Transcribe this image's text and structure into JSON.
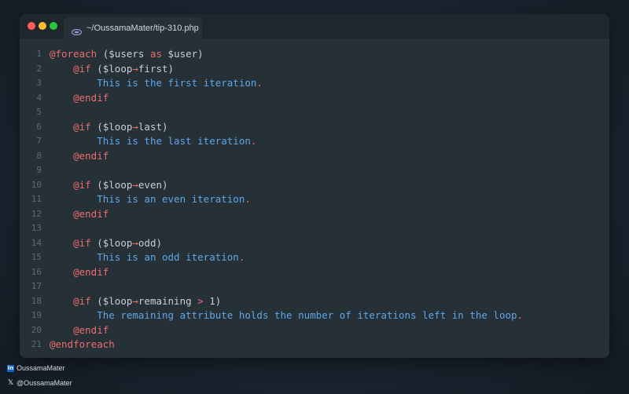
{
  "window": {
    "tab_title": "~/OussamaMater/tip-310.php",
    "traffic_lights": {
      "close": "#ff5f57",
      "minimize": "#febc2e",
      "zoom": "#28c840"
    }
  },
  "colors": {
    "keyword": "#ee6d6d",
    "string_text": "#5fa6e8",
    "plain": "#c9ced3",
    "line_number": "#5d6b76"
  },
  "code": {
    "lines": [
      {
        "n": "1",
        "tokens": [
          {
            "t": "kw",
            "v": "@foreach"
          },
          {
            "t": "plain",
            "v": " ($users "
          },
          {
            "t": "kw",
            "v": "as"
          },
          {
            "t": "plain",
            "v": " $user)"
          }
        ]
      },
      {
        "n": "2",
        "tokens": [
          {
            "t": "plain",
            "v": "    "
          },
          {
            "t": "kw",
            "v": "@if"
          },
          {
            "t": "plain",
            "v": " ($loop"
          },
          {
            "t": "op",
            "v": "→"
          },
          {
            "t": "plain",
            "v": "first)"
          }
        ]
      },
      {
        "n": "3",
        "tokens": [
          {
            "t": "plain",
            "v": "        "
          },
          {
            "t": "text",
            "v": "This is the first iteration"
          },
          {
            "t": "kw",
            "v": "."
          }
        ]
      },
      {
        "n": "4",
        "tokens": [
          {
            "t": "plain",
            "v": "    "
          },
          {
            "t": "kw",
            "v": "@endif"
          }
        ]
      },
      {
        "n": "5",
        "tokens": []
      },
      {
        "n": "6",
        "tokens": [
          {
            "t": "plain",
            "v": "    "
          },
          {
            "t": "kw",
            "v": "@if"
          },
          {
            "t": "plain",
            "v": " ($loop"
          },
          {
            "t": "op",
            "v": "→"
          },
          {
            "t": "plain",
            "v": "last)"
          }
        ]
      },
      {
        "n": "7",
        "tokens": [
          {
            "t": "plain",
            "v": "        "
          },
          {
            "t": "text",
            "v": "This is the last iteration"
          },
          {
            "t": "kw",
            "v": "."
          }
        ]
      },
      {
        "n": "8",
        "tokens": [
          {
            "t": "plain",
            "v": "    "
          },
          {
            "t": "kw",
            "v": "@endif"
          }
        ]
      },
      {
        "n": "9",
        "tokens": []
      },
      {
        "n": "10",
        "tokens": [
          {
            "t": "plain",
            "v": "    "
          },
          {
            "t": "kw",
            "v": "@if"
          },
          {
            "t": "plain",
            "v": " ($loop"
          },
          {
            "t": "op",
            "v": "→"
          },
          {
            "t": "plain",
            "v": "even)"
          }
        ]
      },
      {
        "n": "11",
        "tokens": [
          {
            "t": "plain",
            "v": "        "
          },
          {
            "t": "text",
            "v": "This is an even iteration"
          },
          {
            "t": "kw",
            "v": "."
          }
        ]
      },
      {
        "n": "12",
        "tokens": [
          {
            "t": "plain",
            "v": "    "
          },
          {
            "t": "kw",
            "v": "@endif"
          }
        ]
      },
      {
        "n": "13",
        "tokens": []
      },
      {
        "n": "14",
        "tokens": [
          {
            "t": "plain",
            "v": "    "
          },
          {
            "t": "kw",
            "v": "@if"
          },
          {
            "t": "plain",
            "v": " ($loop"
          },
          {
            "t": "op",
            "v": "→"
          },
          {
            "t": "plain",
            "v": "odd)"
          }
        ]
      },
      {
        "n": "15",
        "tokens": [
          {
            "t": "plain",
            "v": "        "
          },
          {
            "t": "text",
            "v": "This is an odd iteration"
          },
          {
            "t": "kw",
            "v": "."
          }
        ]
      },
      {
        "n": "16",
        "tokens": [
          {
            "t": "plain",
            "v": "    "
          },
          {
            "t": "kw",
            "v": "@endif"
          }
        ]
      },
      {
        "n": "17",
        "tokens": []
      },
      {
        "n": "18",
        "tokens": [
          {
            "t": "plain",
            "v": "    "
          },
          {
            "t": "kw",
            "v": "@if"
          },
          {
            "t": "plain",
            "v": " ($loop"
          },
          {
            "t": "op",
            "v": "→"
          },
          {
            "t": "plain",
            "v": "remaining "
          },
          {
            "t": "op",
            "v": ">"
          },
          {
            "t": "plain",
            "v": " 1)"
          }
        ]
      },
      {
        "n": "19",
        "tokens": [
          {
            "t": "plain",
            "v": "        "
          },
          {
            "t": "text",
            "v": "The remaining attribute holds the number of iterations left in the loop"
          },
          {
            "t": "kw",
            "v": "."
          }
        ]
      },
      {
        "n": "20",
        "tokens": [
          {
            "t": "plain",
            "v": "    "
          },
          {
            "t": "kw",
            "v": "@endif"
          }
        ]
      },
      {
        "n": "21",
        "tokens": [
          {
            "t": "kw",
            "v": "@endforeach"
          }
        ]
      }
    ]
  },
  "footer": {
    "linkedin_icon": "linkedin-icon",
    "linkedin_handle": "OussamaMater",
    "x_icon": "x-icon",
    "x_handle": "@OussamaMater"
  }
}
